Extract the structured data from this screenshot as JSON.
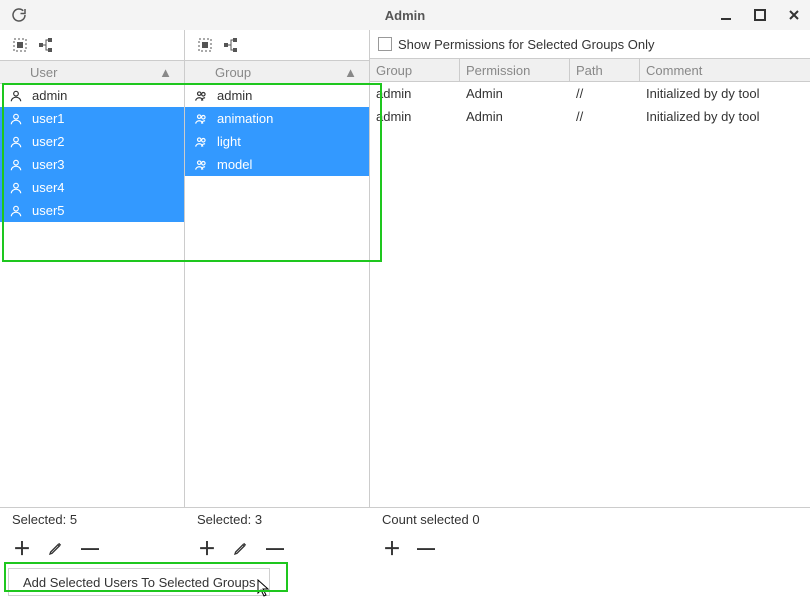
{
  "window": {
    "title": "Admin"
  },
  "panels": {
    "users": {
      "header": "User",
      "items": [
        {
          "name": "admin",
          "selected": false
        },
        {
          "name": "user1",
          "selected": true
        },
        {
          "name": "user2",
          "selected": true
        },
        {
          "name": "user3",
          "selected": true
        },
        {
          "name": "user4",
          "selected": true
        },
        {
          "name": "user5",
          "selected": true
        }
      ],
      "status": "Selected: 5"
    },
    "groups": {
      "header": "Group",
      "items": [
        {
          "name": "admin",
          "selected": false
        },
        {
          "name": "animation",
          "selected": true
        },
        {
          "name": "light",
          "selected": true
        },
        {
          "name": "model",
          "selected": true
        }
      ],
      "status": "Selected: 3"
    },
    "permissions": {
      "checkbox_label": "Show Permissions for Selected Groups Only",
      "columns": {
        "group": "Group",
        "perm": "Permission",
        "path": "Path",
        "comment": "Comment"
      },
      "rows": [
        {
          "group": "admin",
          "perm": "Admin",
          "path": "//",
          "comment": "Initialized by dy tool"
        },
        {
          "group": "admin",
          "perm": "Admin",
          "path": "//",
          "comment": "Initialized by dy tool"
        }
      ],
      "status": "Count selected 0"
    }
  },
  "add_button": "Add Selected Users To Selected Groups",
  "colors": {
    "selection": "#3399ff",
    "highlight": "#1ec71e"
  }
}
